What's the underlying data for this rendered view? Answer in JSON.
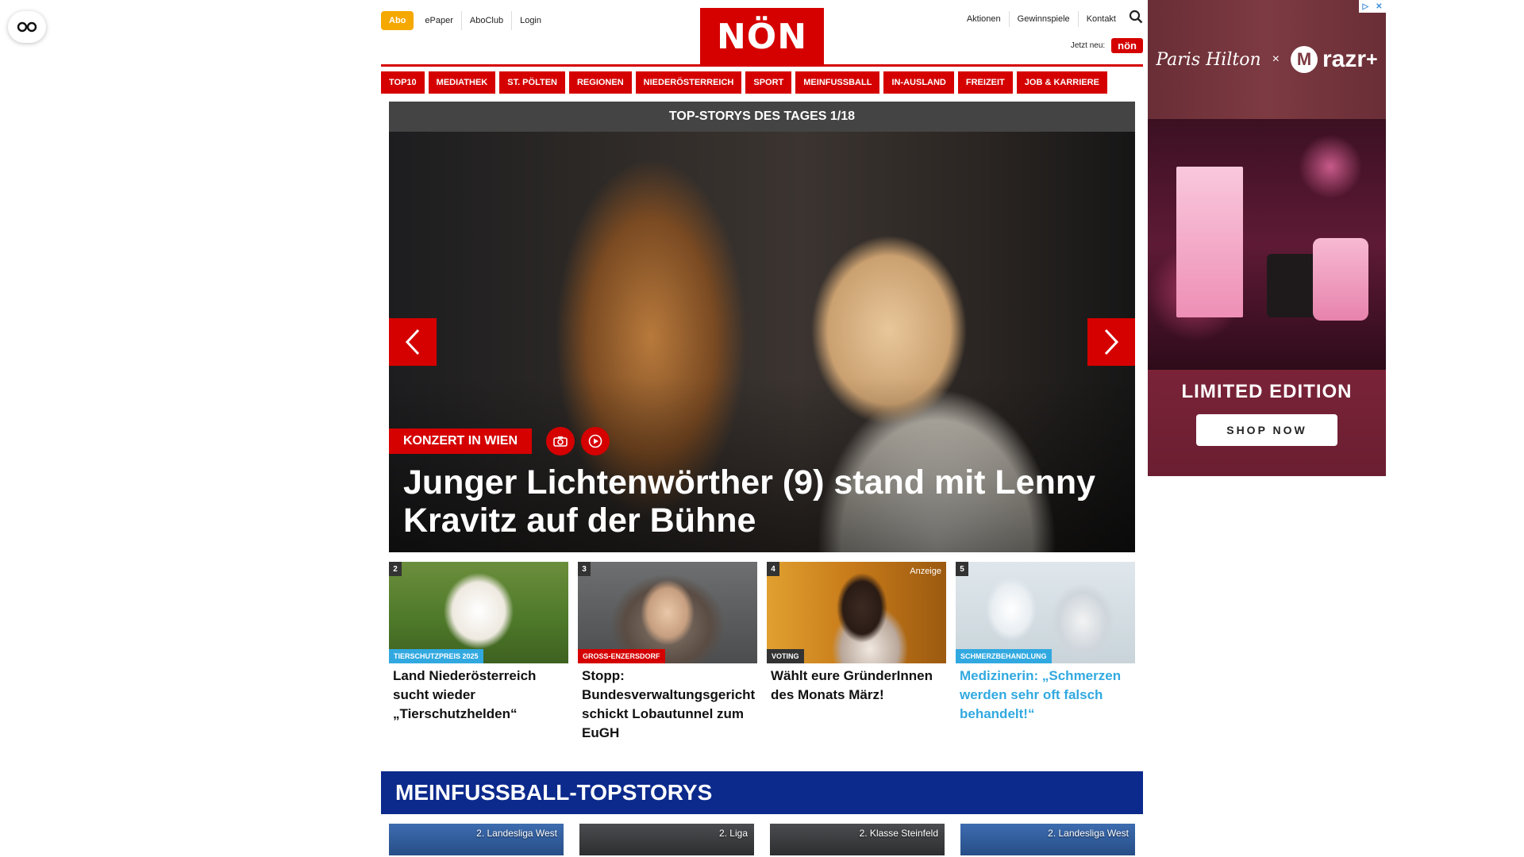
{
  "header": {
    "abo_label": "Abo",
    "links_left": [
      "ePaper",
      "AboClub",
      "Login"
    ],
    "logo_text": "NÖN",
    "links_right": [
      "Aktionen",
      "Gewinnspiele",
      "Kontakt"
    ],
    "jetzt_label": "Jetzt neu:",
    "jetzt_logo": "nön"
  },
  "nav": {
    "items": [
      "TOP10",
      "MEDIATHEK",
      "ST. PÖLTEN",
      "REGIONEN",
      "NIEDERÖSTERREICH",
      "SPORT",
      "MEINFUSSBALL",
      "IN-AUSLAND",
      "FREIZEIT",
      "JOB & KARRIERE"
    ]
  },
  "hero": {
    "bar_title": "TOP-STORYS DES TAGES 1/18",
    "kicker": "KONZERT IN WIEN",
    "title": "Junger Lichtenwörther (9) stand mit Lenny Kravitz auf der Bühne"
  },
  "tiles": [
    {
      "number": "2",
      "tag": "TIERSCHUTZPREIS 2025",
      "tag_color": "#31a9e0",
      "title": "Land Niederösterreich sucht wieder „Tierschutzhelden“"
    },
    {
      "number": "3",
      "tag": "GROSS-ENZERSDORF",
      "tag_color": "#d50000",
      "title": "Stopp: Bundesverwaltungsgericht schickt Lobautunnel zum EuGH"
    },
    {
      "number": "4",
      "ad_label": "Anzeige",
      "tag": "VOTING",
      "tag_color": "#333333",
      "title": "Wählt eure GründerInnen des Monats März!"
    },
    {
      "number": "5",
      "tag": "SCHMERZBEHANDLUNG",
      "tag_color": "#31a9e0",
      "title": "Medizinerin: „Schmerzen werden sehr oft falsch behandelt!“"
    }
  ],
  "football": {
    "heading": "MEINFUSSBALL-TOPSTORYS",
    "tiles": [
      "2. Landesliga West",
      "2. Liga",
      "2. Klasse Steinfeld",
      "2. Landesliga West"
    ]
  },
  "ad": {
    "brand1": "Paris Hilton",
    "x": "×",
    "brand2": "razr",
    "brand2_sup": "+",
    "limited": "LIMITED EDITION",
    "shop": "SHOP NOW"
  },
  "colors": {
    "brand_red": "#d50000",
    "abo_orange": "#f5a800",
    "football_blue": "#0c2a8c"
  }
}
